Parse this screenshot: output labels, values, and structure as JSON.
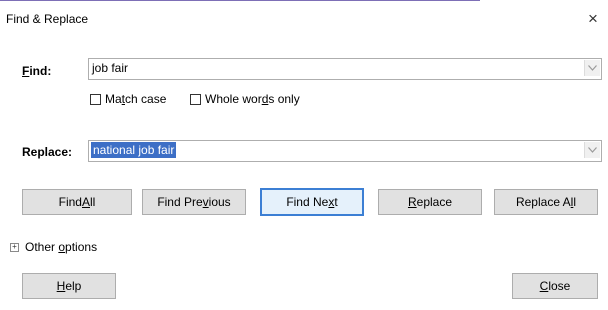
{
  "dialog": {
    "title": "Find & Replace",
    "close_glyph": "×"
  },
  "find": {
    "label_key": "F",
    "label_rest": "ind:",
    "value": "job fair",
    "match_case": {
      "pre": "Ma",
      "key": "t",
      "post": "ch case",
      "checked": false
    },
    "whole_words": {
      "pre": "Whole wor",
      "key": "d",
      "post": "s only",
      "checked": false
    }
  },
  "replace": {
    "label": "Replace:",
    "value": "national job fair"
  },
  "buttons": {
    "find_all": {
      "pre": "Find ",
      "key": "A",
      "post": "ll"
    },
    "find_previous": {
      "pre": "Find Pre",
      "key": "v",
      "post": "ious"
    },
    "find_next": {
      "pre": "Find Ne",
      "key": "x",
      "post": "t"
    },
    "replace": {
      "pre": "",
      "key": "R",
      "post": "eplace"
    },
    "replace_all": {
      "pre": "Replace A",
      "key": "l",
      "post": "l"
    }
  },
  "other_options": {
    "pre": "Other ",
    "key": "o",
    "post": "ptions",
    "glyph": "+"
  },
  "footer": {
    "help": {
      "key": "H",
      "post": "elp"
    },
    "close": {
      "key": "C",
      "post": "lose"
    }
  },
  "colors": {
    "accent": "#3c7fd4",
    "selection": "#3d6fc6"
  }
}
